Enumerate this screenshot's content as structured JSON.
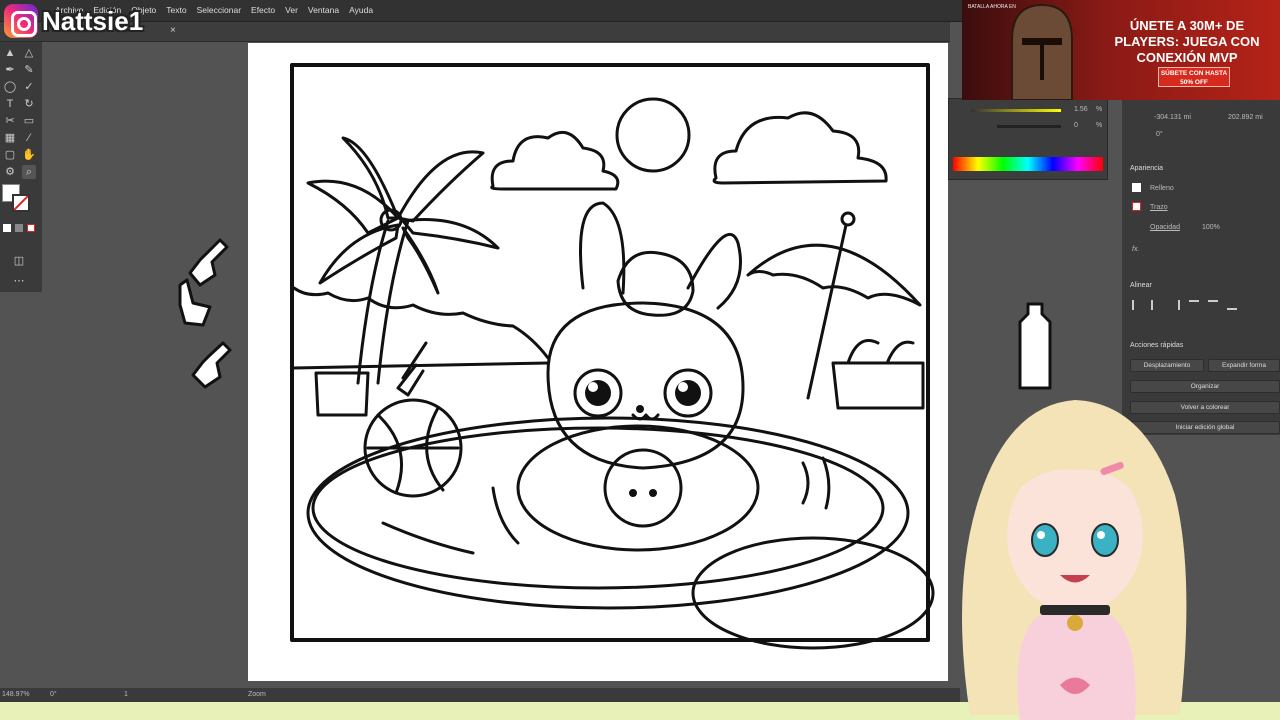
{
  "streamer": {
    "name": "Nattsie1"
  },
  "menu": [
    "Archivo",
    "Edición",
    "Objeto",
    "Texto",
    "Seleccionar",
    "Efecto",
    "Ver",
    "Ventana",
    "Ayuda"
  ],
  "doc": {
    "close": "×"
  },
  "status": {
    "zoom": "148.97%",
    "angle": "0°",
    "artboard": "1",
    "mode": "Zoom"
  },
  "transform": {
    "y": "-304.131 mi",
    "h": "202.892 mi",
    "angle": "0°"
  },
  "color": {
    "val1": "1.56",
    "val2": "0",
    "pct": "%"
  },
  "appearance": {
    "title": "Apariencia",
    "fill": "Relleno",
    "stroke": "Trazo",
    "opacity_label": "Opacidad",
    "opacity": "100%",
    "fx": "fx."
  },
  "align": {
    "title": "Alinear"
  },
  "quick": {
    "title": "Acciones rápidas",
    "offset": "Desplazamiento",
    "expand": "Expandir forma",
    "arrange": "Organizar",
    "recolor": "Volver a colorear",
    "global_edit": "Iniciar edición global"
  },
  "ad": {
    "headline": "ÚNETE A 30M+ DE PLAYERS: JUEGA CON CONEXIÓN MVP",
    "cta": "SÚBETE CON HASTA 50% OFF",
    "small": "BATALLA AHORA EN"
  },
  "icons": [
    "instagram-icon",
    "selection-tool-icon",
    "direct-selection-icon",
    "pen-tool-icon",
    "brush-icon",
    "ellipse-icon",
    "type-icon",
    "rotate-icon",
    "scissors-icon",
    "zoom-icon",
    "shovel-sticker-icon",
    "bottle-sticker-icon"
  ]
}
